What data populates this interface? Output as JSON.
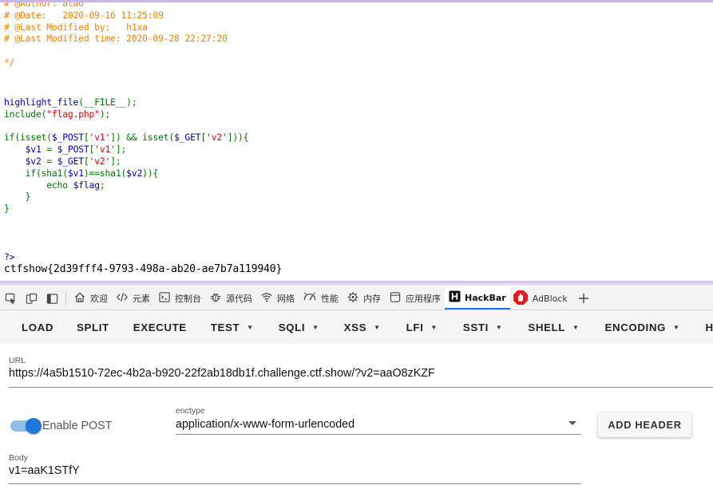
{
  "code": {
    "comment_lines": [
      "# @Author: atao",
      "# @Date:   2020-09-16 11:25:09",
      "# @Last Modified by:   h1xa",
      "# @Last Modified time: 2020-09-28 22:27:20"
    ],
    "comment_close": "*/",
    "line_hl_fn": "highlight_file",
    "line_hl_rest": "(__FILE__);",
    "line_inc_fn": "include(",
    "line_inc_str": "\"flag.php\"",
    "line_inc_end": ");",
    "if_a": "if(isset(",
    "if_var1": "$_POST",
    "if_b": "[",
    "if_str1": "'v1'",
    "if_c": "]) && isset(",
    "if_var2": "$_GET",
    "if_d": "[",
    "if_str2": "'v2'",
    "if_e": "])){",
    "a1_var": "    $v1",
    "a1_eq": " = ",
    "a1_src": "$_POST",
    "a1_b": "[",
    "a1_str": "'v1'",
    "a1_e": "];",
    "a2_var": "    $v2",
    "a2_eq": " = ",
    "a2_src": "$_GET",
    "a2_b": "[",
    "a2_str": "'v2'",
    "a2_e": "];",
    "sha_a": "    if(sha1(",
    "sha_v1": "$v1",
    "sha_b": ")==sha1(",
    "sha_v2": "$v2",
    "sha_c": ")){",
    "echo_kw": "        echo ",
    "echo_var": "$flag",
    "echo_end": ";",
    "brace1": "    }",
    "brace2": "}",
    "close_tag": "?>"
  },
  "flag_output": "ctfshow{2d39fff4-9793-498a-ab20-ae7b7a119940}",
  "devtools_tabs": [
    {
      "label": "欢迎",
      "icon": "home-icon"
    },
    {
      "label": "元素",
      "icon": "code-icon"
    },
    {
      "label": "控制台",
      "icon": "console-icon"
    },
    {
      "label": "源代码",
      "icon": "bug-icon"
    },
    {
      "label": "网络",
      "icon": "wifi-icon"
    },
    {
      "label": "性能",
      "icon": "gauge-icon"
    },
    {
      "label": "内存",
      "icon": "chip-icon"
    },
    {
      "label": "应用程序",
      "icon": "app-icon"
    },
    {
      "label": "HackBar",
      "icon": "hackbar-icon"
    },
    {
      "label": "AdBlock",
      "icon": "adblock-icon"
    }
  ],
  "hackbar_menu": {
    "load": "LOAD",
    "split": "SPLIT",
    "execute": "EXECUTE",
    "test": "TEST",
    "sqli": "SQLI",
    "xss": "XSS",
    "lfi": "LFI",
    "ssti": "SSTI",
    "shell": "SHELL",
    "encoding": "ENCODING",
    "hashing": "HASHING"
  },
  "form": {
    "url_label": "URL",
    "url_value": "https://4a5b1510-72ec-4b2a-b920-22f2ab18db1f.challenge.ctf.show/?v2=aaO8zKZF",
    "enable_post_label": "Enable POST",
    "enable_post_on": true,
    "enctype_label": "enctype",
    "enctype_value": "application/x-www-form-urlencoded",
    "add_header_label": "ADD HEADER",
    "body_label": "Body",
    "body_value": "v1=aaK1STfY"
  },
  "colors": {
    "comment": "#ff8000",
    "keyword": "#007700",
    "variable": "#0000bb",
    "string": "#dd0000",
    "accent": "#1e78d8",
    "hackbar_bg": "#f5f5f5"
  }
}
